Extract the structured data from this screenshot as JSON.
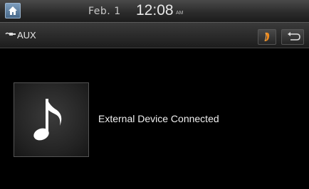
{
  "status_bar": {
    "date": "Feb.  1",
    "time": "12:08",
    "ampm": "AM"
  },
  "source_bar": {
    "source_label": "AUX",
    "source_icon": "aux-cable-icon",
    "menu_icon": "sound-settings-icon",
    "back_icon": "back-arrow-icon"
  },
  "main": {
    "album_art_icon": "music-note-icon",
    "status_message": "External Device Connected"
  },
  "colors": {
    "home_button": "#5f7f9f",
    "menu_accent": "#f08a1c",
    "background": "#000000"
  }
}
